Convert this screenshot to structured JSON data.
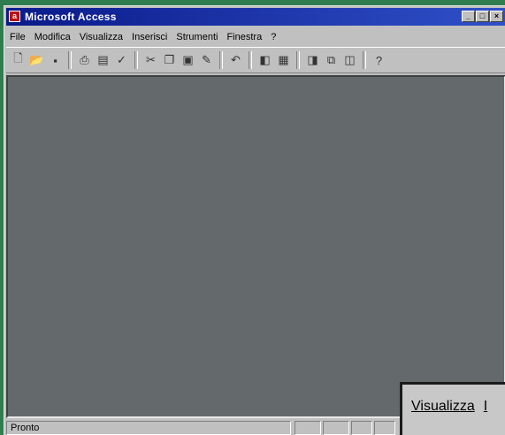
{
  "window": {
    "title": "Microsoft Access",
    "controls": [
      "_",
      "□",
      "×"
    ]
  },
  "menu": [
    "File",
    "Modifica",
    "Visualizza",
    "Inserisci",
    "Strumenti",
    "Finestra",
    "?"
  ],
  "toolbar": {
    "icons": [
      "new-icon",
      "open-icon",
      "save-icon",
      "print-icon",
      "print-preview-icon",
      "spelling-icon",
      "cut-icon",
      "copy-icon",
      "paste-icon",
      "format-painter-icon",
      "undo-icon",
      "office-links-icon",
      "analyze-icon",
      "properties-icon",
      "relationships-icon",
      "new-object-icon",
      "help-icon"
    ]
  },
  "status": {
    "text": "Pronto"
  },
  "zoom_overlay": {
    "menu": [
      "Visualizza",
      "I"
    ]
  }
}
